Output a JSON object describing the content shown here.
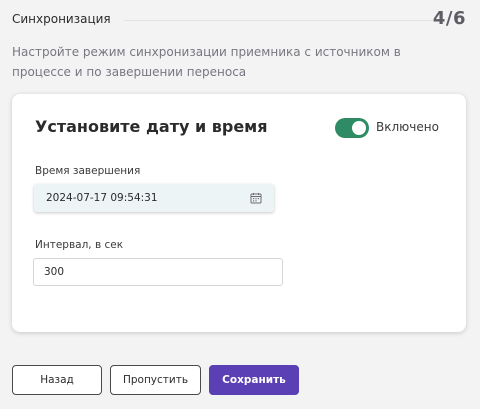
{
  "header": {
    "title": "Синхронизация",
    "step": "4/6"
  },
  "description": "Настройте режим синхронизации приемника с источником в процессе и по завершении переноса",
  "card": {
    "title": "Установите дату и время",
    "toggle": {
      "label": "Включено",
      "checked": true,
      "color": "#2e8b63"
    },
    "end_time": {
      "label": "Время завершения",
      "value": "2024-07-17 09:54:31",
      "icon": "calendar-icon"
    },
    "interval": {
      "label": "Интервал, в сек",
      "value": "300"
    }
  },
  "buttons": {
    "back": "Назад",
    "skip": "Пропустить",
    "save": "Сохранить",
    "primary_color": "#5a3fb5"
  }
}
